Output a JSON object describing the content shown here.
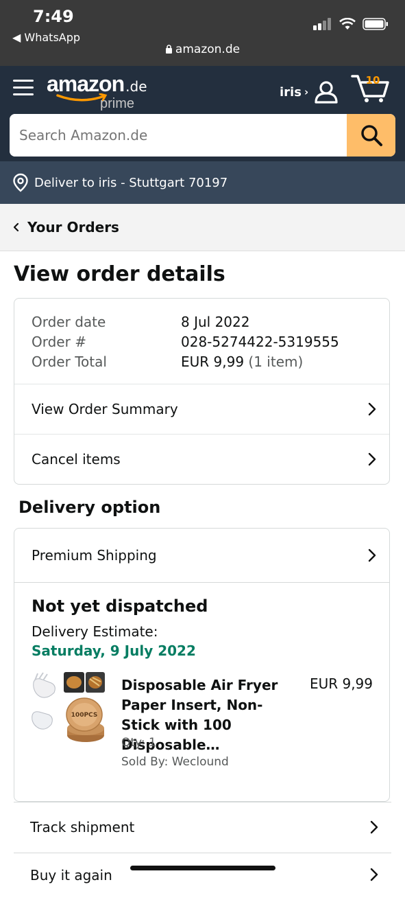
{
  "status_bar": {
    "time": "7:49",
    "back_app": "WhatsApp",
    "url": "amazon.de"
  },
  "header": {
    "logo_text": "amazon",
    "logo_tld": ".de",
    "logo_sub": "prime",
    "account_label": "iris",
    "account_chevron": "›",
    "cart_count": "10",
    "search_placeholder": "Search Amazon.de",
    "accent_color": "#febd69"
  },
  "deliver_bar": {
    "text": "Deliver to iris - Stuttgart 70197"
  },
  "breadcrumb": {
    "label": "Your Orders"
  },
  "page": {
    "title": "View order details"
  },
  "order": {
    "date_label": "Order date",
    "date_value": "8 Jul 2022",
    "number_label": "Order #",
    "number_value": "028-5274422-5319555",
    "total_label": "Order Total",
    "total_value": "EUR 9,99",
    "total_items": "(1 item)",
    "actions": [
      "View Order Summary",
      "Cancel items"
    ]
  },
  "delivery": {
    "heading": "Delivery option",
    "option": "Premium Shipping",
    "status": "Not yet dispatched",
    "estimate_label": "Delivery Estimate:",
    "estimate_date": "Saturday, 9 July 2022",
    "status_color": "#067d62",
    "product": {
      "title": "Disposable Air Fryer Paper Insert, Non-Stick with 100 Disposable…",
      "price": "EUR 9,99",
      "qty": "Qty: 1",
      "sold_by": "Sold By: Weclound",
      "image_badge": "100PCS"
    }
  },
  "actions": {
    "track": "Track shipment",
    "buy_again": "Buy it again"
  }
}
